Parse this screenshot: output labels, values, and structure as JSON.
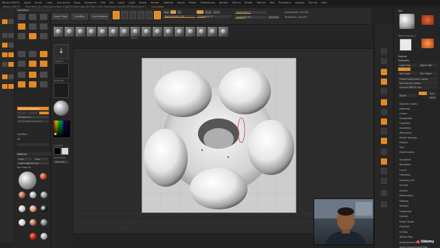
{
  "menubar": {
    "items": [
      "ZBrush 4R8 P2",
      "Alpha",
      "Brush",
      "Color",
      "Document",
      "Draw",
      "Dynamics",
      "Edit",
      "File",
      "Layer",
      "Light",
      "Macro",
      "Marker",
      "Material",
      "Movie",
      "Picker",
      "Preferences",
      "Render",
      "Stencil",
      "Stroke",
      "Texture",
      "Tool",
      "Transform",
      "Zplugin",
      "Zscript",
      "Help"
    ]
  },
  "statusbar": {
    "title": "ZBrush 4R8 P2",
    "info": "Free Mem 28.71GB  Active Mem 2,849  Scratch Disk 48  Timer 0.001  PolyCount 204.392 KP  MeshCount 1",
    "tag": "QuickSave"
  },
  "left_panel": {
    "title": "Transform",
    "edit_label": "Edit",
    "draw_label": "Draw",
    "move_label": "Move",
    "scale_label": "Scale",
    "rotate_label": "Rotate",
    "activate_symmetry": "Activate Symmetry",
    "radial_count": "RadialCount",
    "use_posable": "Use Posable Symmetry",
    "modifiers": "Modifiers",
    "alternate": "Alt",
    "material_header": "Material",
    "load_label": "Load",
    "save_label": "Save",
    "lightbox_materials": "Lightbox▶Materials",
    "basic_material": "BasicMaterial",
    "materials": [
      "MatCap Gray",
      "MatCap Red Wax",
      "SkinShade4",
      "BasicMaterial",
      "Chalk",
      "DoubleShade1",
      "SkinShade4",
      "MatCap White01",
      "ReflectedMap"
    ]
  },
  "toolbar": {
    "home_page": "Home Page",
    "lightbox": "LightBox",
    "live_boolean": "Live Boolean",
    "mrgb": "Mrgb",
    "rgb": "Rgb",
    "m": "M",
    "zadd": "Zadd",
    "zsub": "Zsub",
    "zcut": "Zcut",
    "rgb_intensity": "Rgb Intensity 100",
    "z_intensity": "Z Intensity 25",
    "focal_shift": "Focal Shift 0",
    "draw_size": "Draw Size 64",
    "active_points": "ActivePoints: 204,392",
    "total_points": "TotalPoints: 204,392",
    "dynamic": "Dynamic"
  },
  "brushes": {
    "items": [
      "Standard",
      "ClayBuildup",
      "Move",
      "DamStandard",
      "Inflate",
      "Pinch",
      "Smooth",
      "hPolish",
      "TrimDynamic",
      "SnakeHook",
      "Move Topological",
      "Dam",
      "Clay",
      "Flatten",
      "Polish",
      "Layer"
    ],
    "caption": "Spline"
  },
  "tool_column": {
    "stroke": "DragRect",
    "alpha": "Alpha Off",
    "texture": "Texture Off",
    "material": "MatCap Gray",
    "gradient": "Gradient",
    "switch_color": "SwitchColor",
    "alternate": "Alternate"
  },
  "right_panel": {
    "tool_label": "Tool",
    "pm3d_label": "PM3D_Sphere3D_1",
    "subtool": "Subtool",
    "geometry": "Geometry",
    "lower_res": "Lower Res",
    "higher_res": "Higher Res",
    "sdiv": "SDiv",
    "del_lower": "Del Lower",
    "del_higher": "Del Higher",
    "freeze_subdiv": "Freeze SubDivision Levels",
    "reconstruct": "Reconstruct Subdiv",
    "convert_bpr": "Convert BPR To Geo",
    "divide": "Divide",
    "smt": "Smt",
    "suv": "Suv",
    "relax": "ReUV",
    "sections": [
      "Dynamic Subdiv",
      "Edgeloop",
      "Crease",
      "ShadowBox",
      "ClayPolish",
      "DynaMesh",
      "ZRemesher",
      "Modify Topology",
      "Position",
      "Size",
      "MeshIntegrity"
    ],
    "menus": [
      "ArrayMesh",
      "NanoMesh",
      "Layers",
      "FiberMesh",
      "Geometry HD",
      "Preview",
      "Surface",
      "Deformation",
      "Masking",
      "Visibility",
      "Polygroups",
      "Contact",
      "Morph Target",
      "Polypaint",
      "UV Map",
      "Texture Map",
      "Displacement Map",
      "Vector Displacement Map"
    ]
  },
  "udemy": {
    "brand": "Udemy"
  },
  "colors": {
    "accent": "#e38a24",
    "panel": "#262626",
    "viewport": "#2c2c2c"
  }
}
